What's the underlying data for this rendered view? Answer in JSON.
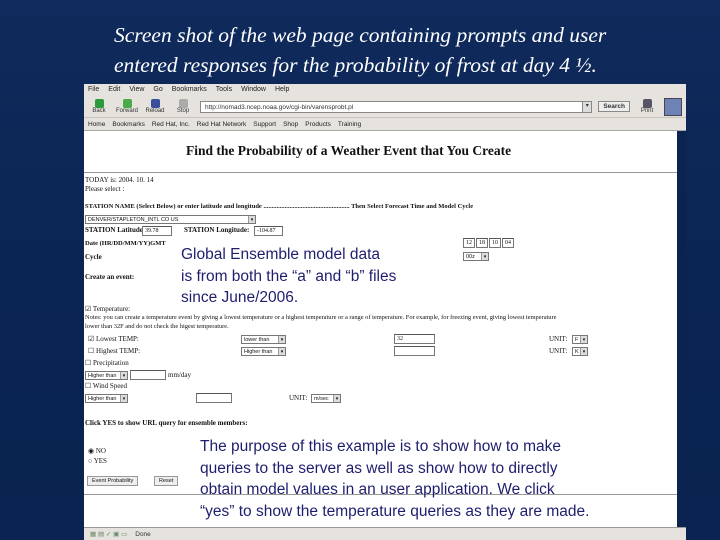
{
  "slide": {
    "title_line1": "Screen shot of the web page containing prompts and user",
    "title_line2": "entered responses for the probability of frost at day 4 ½."
  },
  "browser": {
    "menu": [
      "File",
      "Edit",
      "View",
      "Go",
      "Bookmarks",
      "Tools",
      "Window",
      "Help"
    ],
    "toolbar": {
      "back": "Back",
      "forward": "Forward",
      "reload": "Reload",
      "stop": "Stop",
      "url": "http://nomad3.ncep.noaa.gov/cgi-bin/varensprobt.pl",
      "search": "Search",
      "print": "Print"
    },
    "bookmarks": [
      "Home",
      "Bookmarks",
      "Red Hat, Inc.",
      "Red Hat Network",
      "Support",
      "Shop",
      "Products",
      "Training"
    ],
    "status": "Done"
  },
  "page": {
    "heading": "Find the Probability of a Weather Event that You Create",
    "today": "TODAY is: 2004. 10. 14",
    "please": "Please select :",
    "station_prompt": "STATION NAME (Select Below) or enter latitude and longitude ..................................................... Then Select Forecast Time and Model Cycle",
    "station": "DENVER/STAPLETON_INTL CO US",
    "lat_label": "STATION Latitude:",
    "lat": "39.78",
    "lon_label": "STATION Longitude:",
    "lon": "-104.87",
    "date_label": "Date (HR/DD/MM/YY)GMT",
    "date": [
      "12",
      "18",
      "10",
      "04"
    ],
    "cycle_label": "Cycle",
    "cycle": "00z",
    "create_label": "Create an event:",
    "temperature": "Temperature:",
    "notes": "Notes: you can create a temperature event by giving a lowest temperature or a highest temperature or a range of temperature. For example, for freezing event, giving lowest temperature",
    "notes2": "lower than 32F and do not check the higest temperature.",
    "lowest": "Lowest TEMP:",
    "lowest_op": "lower than",
    "lowest_val": "32",
    "unit_label": "UNIT:",
    "lowest_unit": "F",
    "highest": "Highest TEMP:",
    "highest_op": "Higher than",
    "highest_unit": "K",
    "precip": "Precipitation",
    "precip_op": "Higher than",
    "precip_unit": "mm/day",
    "wind": "Wind Speed",
    "wind_op": "Higher than",
    "wind_unit": "m/sec",
    "yes_prompt": "Click YES to show URL query for ensemble members:",
    "no": "NO",
    "yes": "YES",
    "submit": "Event Probability",
    "reset": "Reset"
  },
  "overlay": {
    "note1": [
      "Global Ensemble model data",
      "is from both the “a” and “b” files",
      "since June/2006."
    ],
    "note2": [
      "The purpose of this example is to show how to make",
      "queries to the server as well as show how to directly",
      "obtain model values in an user application.  We click",
      "“yes” to show the temperature queries as they are made."
    ]
  }
}
